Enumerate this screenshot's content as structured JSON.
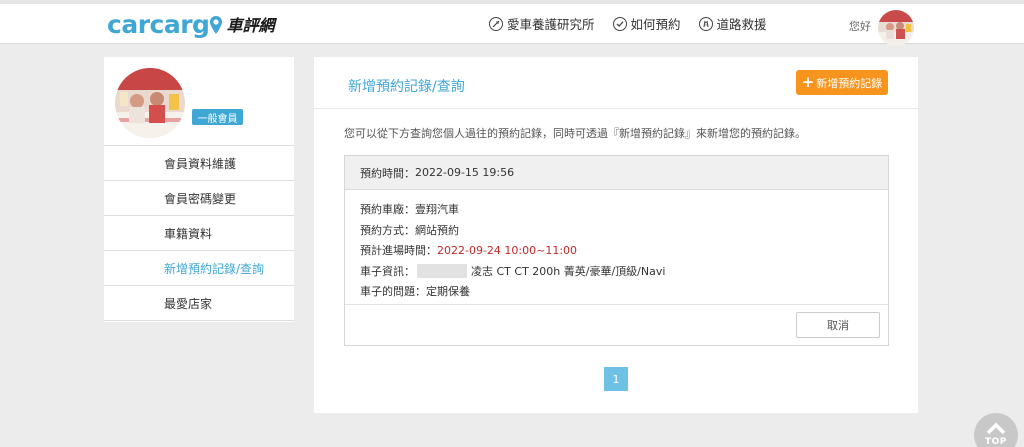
{
  "header": {
    "logo_text": "carcarg",
    "logo_cn": "車評網",
    "nav": [
      {
        "label": "愛車養護研究所",
        "icon": "wrench-circle-icon"
      },
      {
        "label": "如何預約",
        "icon": "check-circle-icon"
      },
      {
        "label": "道路救援",
        "icon": "road-circle-icon"
      }
    ],
    "greeting": "您好"
  },
  "sidebar": {
    "badge": "一般會員",
    "items": [
      {
        "label": "會員資料維護"
      },
      {
        "label": "會員密碼變更"
      },
      {
        "label": "車籍資料"
      },
      {
        "label": "新增預約記錄/查詢"
      },
      {
        "label": "最愛店家"
      }
    ]
  },
  "main": {
    "title": "新增預約記錄/查詢",
    "add_button": "新增預約記錄",
    "description": "您可以從下方查詢您個人過往的預約記錄，同時可透過『新增預約記錄』來新增您的預約記錄。",
    "booking": {
      "time_label": "預約時間：",
      "time_value": "2022-09-15 19:56",
      "shop_label": "預約車廠：",
      "shop_value": "壹翔汽車",
      "method_label": "預約方式：",
      "method_value": "網站預約",
      "arrival_label": "預計進場時間：",
      "arrival_value": "2022-09-24 10:00~11:00",
      "car_label": "車子資訊：",
      "car_value": "凌志 CT CT 200h 菁英/豪華/頂級/Navi",
      "issue_label": "車子的問題：",
      "issue_value": "定期保養",
      "cancel": "取消"
    },
    "pagination": {
      "current": "1"
    }
  },
  "back_to_top": "TOP",
  "colors": {
    "brand": "#3fa7d6",
    "accent_orange": "#f7941d",
    "highlight_red": "#c62828"
  }
}
